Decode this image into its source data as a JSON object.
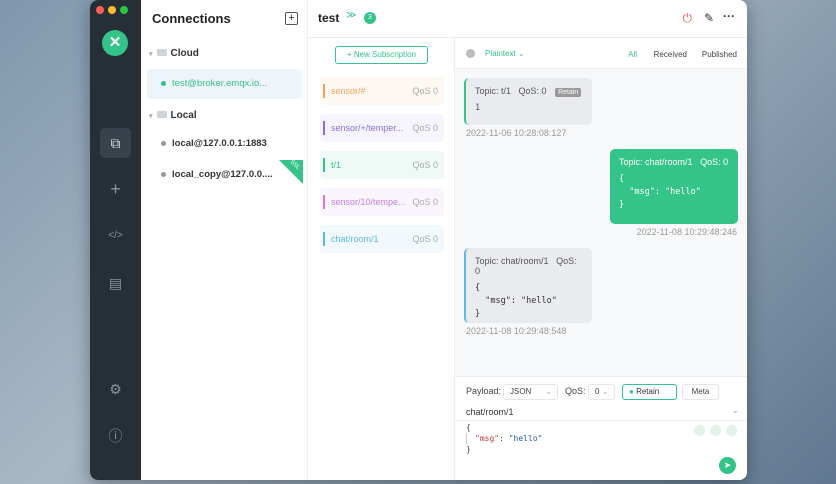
{
  "sidebar": {
    "logo": "✕",
    "icons": [
      "connections-icon",
      "new-connection-icon",
      "script-icon",
      "log-icon",
      "settings-icon",
      "help-icon"
    ]
  },
  "connections": {
    "title": "Connections",
    "groups": [
      {
        "name": "Cloud",
        "items": [
          {
            "label": "test@broker.emqx.io..."
          }
        ]
      },
      {
        "name": "Local",
        "items": [
          {
            "label": "local@127.0.0.1:1883"
          },
          {
            "label": "local_copy@127.0.0...."
          }
        ]
      }
    ],
    "ssl_badge": "SSL"
  },
  "header": {
    "title": "test",
    "count": "3"
  },
  "subscriptions": {
    "new_label": "+ New Subscription",
    "items": [
      {
        "topic": "sensor/#",
        "qos": "QoS 0",
        "color": "#f0a35e"
      },
      {
        "topic": "sensor/+/temper...",
        "qos": "QoS 0",
        "color": "#8e6fd8"
      },
      {
        "topic": "t/1",
        "qos": "QoS 0",
        "color": "#34c388"
      },
      {
        "topic": "sensor/10/tempe...",
        "qos": "QoS 0",
        "color": "#c57ee0"
      },
      {
        "topic": "chat/room/1",
        "qos": "QoS 0",
        "color": "#5fb8e0"
      }
    ]
  },
  "messages": {
    "format": "Plaintext",
    "filters": [
      "All",
      "Received",
      "Published"
    ],
    "list": [
      {
        "topic": "Topic: t/1",
        "qos": "QoS: 0",
        "retain": "Retain",
        "payload": "1",
        "time": "2022-11-06 10:28:08:127"
      },
      {
        "topic": "Topic: chat/room/1",
        "qos": "QoS: 0",
        "payload": "{\n  \"msg\": \"hello\"\n}",
        "time": "2022-11-08 10:29:48:246"
      },
      {
        "topic": "Topic: chat/room/1",
        "qos": "QoS: 0",
        "payload": "{\n  \"msg\": \"hello\"\n}",
        "time": "2022-11-08 10:29:48:548"
      }
    ]
  },
  "publish": {
    "payload_label": "Payload:",
    "payload_type": "JSON",
    "qos_label": "QoS:",
    "qos": "0",
    "retain": "Retain",
    "meta": "Meta",
    "topic": "chat/room/1",
    "body_open": "{",
    "body_key": "\"msg\"",
    "body_sep": ": ",
    "body_val": "\"hello\"",
    "body_close": "}"
  }
}
